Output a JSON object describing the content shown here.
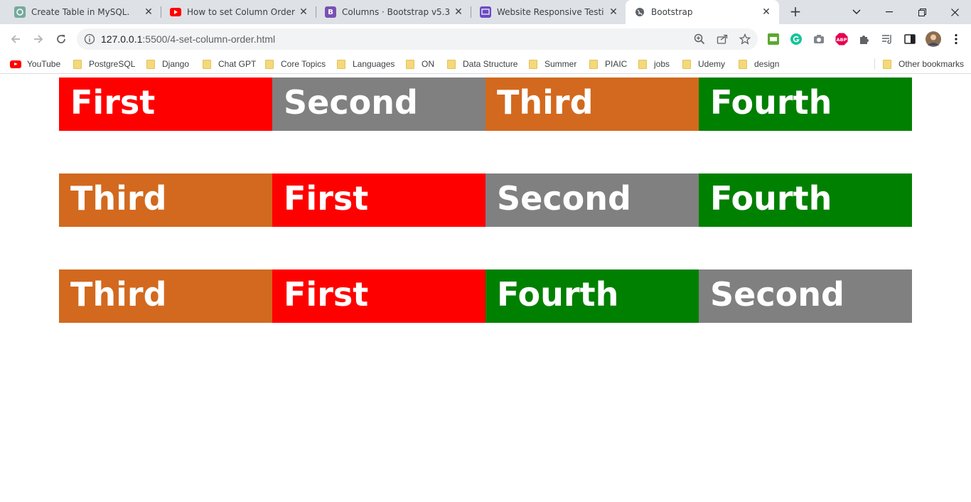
{
  "tabs": [
    {
      "title": "Create Table in MySQL.",
      "icon": "chatgpt-icon",
      "color": "#74aa9c"
    },
    {
      "title": "How to set Column Order in B",
      "icon": "youtube-icon",
      "color": "#ff0000"
    },
    {
      "title": "Columns · Bootstrap v5.3",
      "icon": "bootstrap-icon",
      "color": "#7952b3"
    },
    {
      "title": "Website Responsive Testing T",
      "icon": "responsive-test-icon",
      "color": "#6a4bc4"
    },
    {
      "title": "Bootstrap",
      "icon": "globe-icon",
      "color": "#5f6368"
    }
  ],
  "url": {
    "host": "127.0.0.1",
    "path": ":5500/4-set-column-order.html"
  },
  "bookmarks": [
    {
      "label": "YouTube",
      "type": "youtube"
    },
    {
      "label": "PostgreSQL",
      "type": "folder"
    },
    {
      "label": "Django",
      "type": "folder"
    },
    {
      "label": "Chat GPT",
      "type": "folder"
    },
    {
      "label": "Core Topics",
      "type": "folder"
    },
    {
      "label": "Languages",
      "type": "folder"
    },
    {
      "label": "ON",
      "type": "folder"
    },
    {
      "label": "Data Structure",
      "type": "folder"
    },
    {
      "label": "Summer",
      "type": "folder"
    },
    {
      "label": "PIAIC",
      "type": "folder"
    },
    {
      "label": "jobs",
      "type": "folder"
    },
    {
      "label": "Udemy",
      "type": "folder"
    },
    {
      "label": "design",
      "type": "folder"
    }
  ],
  "other_bookmarks": "Other bookmarks",
  "colors": {
    "First": "#ff0000",
    "Second": "#808080",
    "Third": "#d2691e",
    "Fourth": "#008000"
  },
  "rows": [
    [
      "First",
      "Second",
      "Third",
      "Fourth"
    ],
    [
      "Third",
      "First",
      "Second",
      "Fourth"
    ],
    [
      "Third",
      "First",
      "Fourth",
      "Second"
    ]
  ]
}
